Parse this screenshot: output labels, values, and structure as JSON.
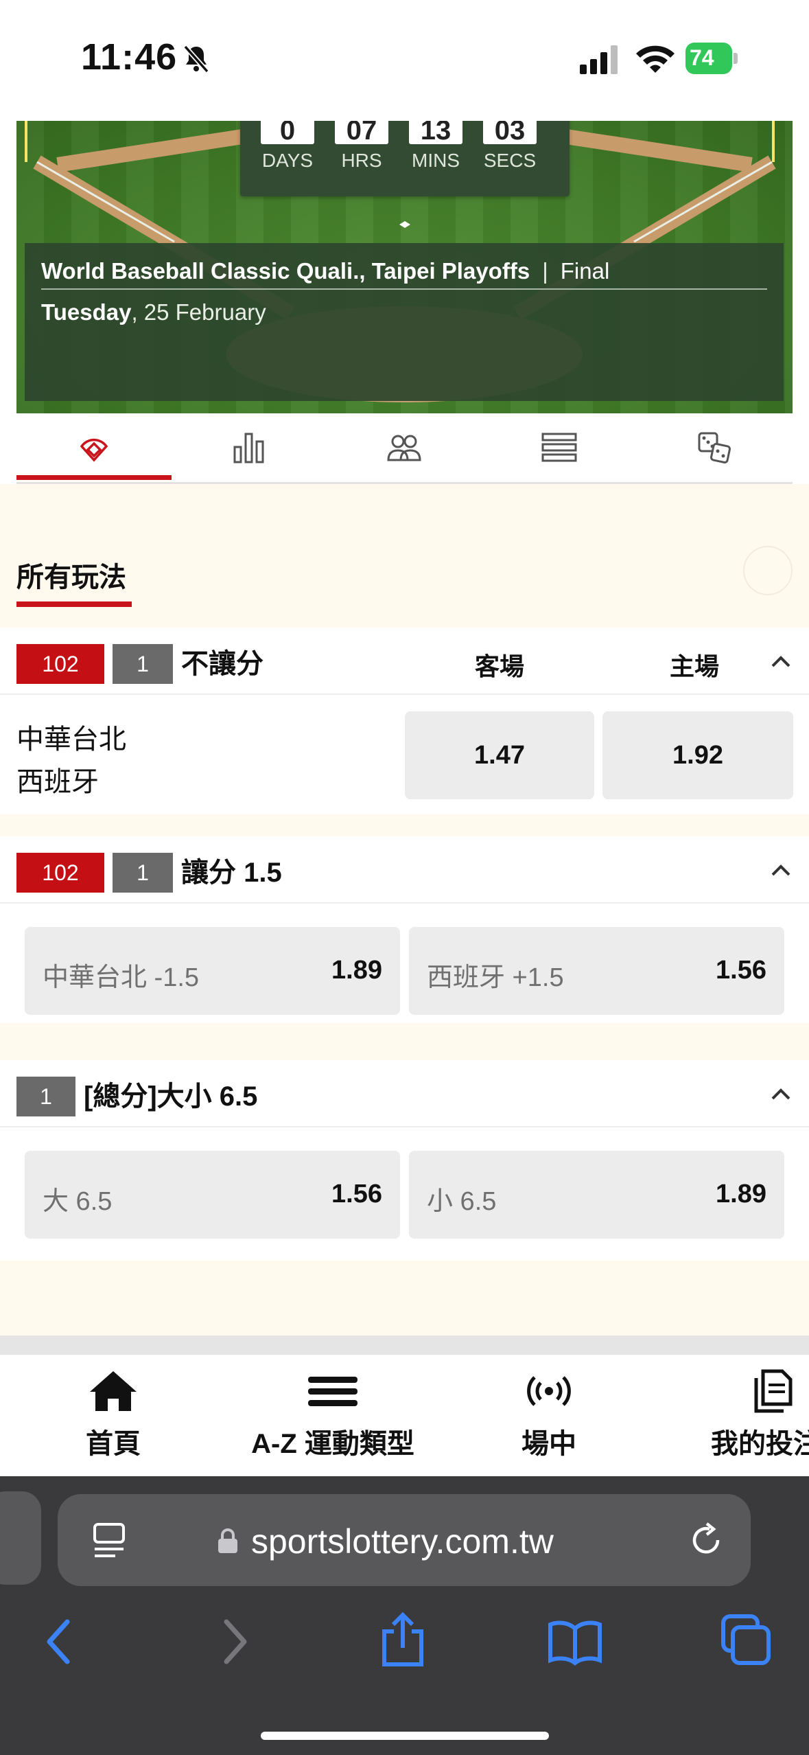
{
  "status_bar": {
    "time": "11:46",
    "battery": "74"
  },
  "countdown": {
    "items": [
      {
        "value": "0",
        "label": "DAYS"
      },
      {
        "value": "07",
        "label": "HRS"
      },
      {
        "value": "13",
        "label": "MINS"
      },
      {
        "value": "03",
        "label": "SECS"
      }
    ]
  },
  "match": {
    "competition": "World Baseball Classic Quali., Taipei Playoffs",
    "separator": "|",
    "stage": "Final",
    "day": "Tuesday",
    "date": ", 25 February"
  },
  "tabs": [
    {
      "icon": "baseball-field-icon",
      "active": true
    },
    {
      "icon": "bar-chart-icon",
      "active": false
    },
    {
      "icon": "players-icon",
      "active": false
    },
    {
      "icon": "list-icon",
      "active": false
    },
    {
      "icon": "dice-icon",
      "active": false
    }
  ],
  "markets_title": "所有玩法",
  "markets": {
    "moneyline": {
      "code": "102",
      "count": "1",
      "name": "不讓分",
      "col_away": "客場",
      "col_home": "主場",
      "team1": "中華台北",
      "team2": "西班牙",
      "odd_away": "1.47",
      "odd_home": "1.92"
    },
    "handicap": {
      "code": "102",
      "count": "1",
      "name": "讓分 1.5",
      "opt1_label": "中華台北 -1.5",
      "opt1_odd": "1.89",
      "opt2_label": "西班牙 +1.5",
      "opt2_odd": "1.56"
    },
    "total": {
      "count": "1",
      "name": "[總分]大小 6.5",
      "opt1_label": "大 6.5",
      "opt1_odd": "1.56",
      "opt2_label": "小 6.5",
      "opt2_odd": "1.89"
    }
  },
  "bottom_nav": [
    {
      "label": "首頁",
      "icon": "home-icon"
    },
    {
      "label": "A-Z 運動類型",
      "icon": "menu-icon"
    },
    {
      "label": "場中",
      "icon": "live-icon"
    },
    {
      "label": "我的投注",
      "icon": "my-bets-icon"
    }
  ],
  "browser": {
    "url": "sportslottery.com.tw"
  }
}
